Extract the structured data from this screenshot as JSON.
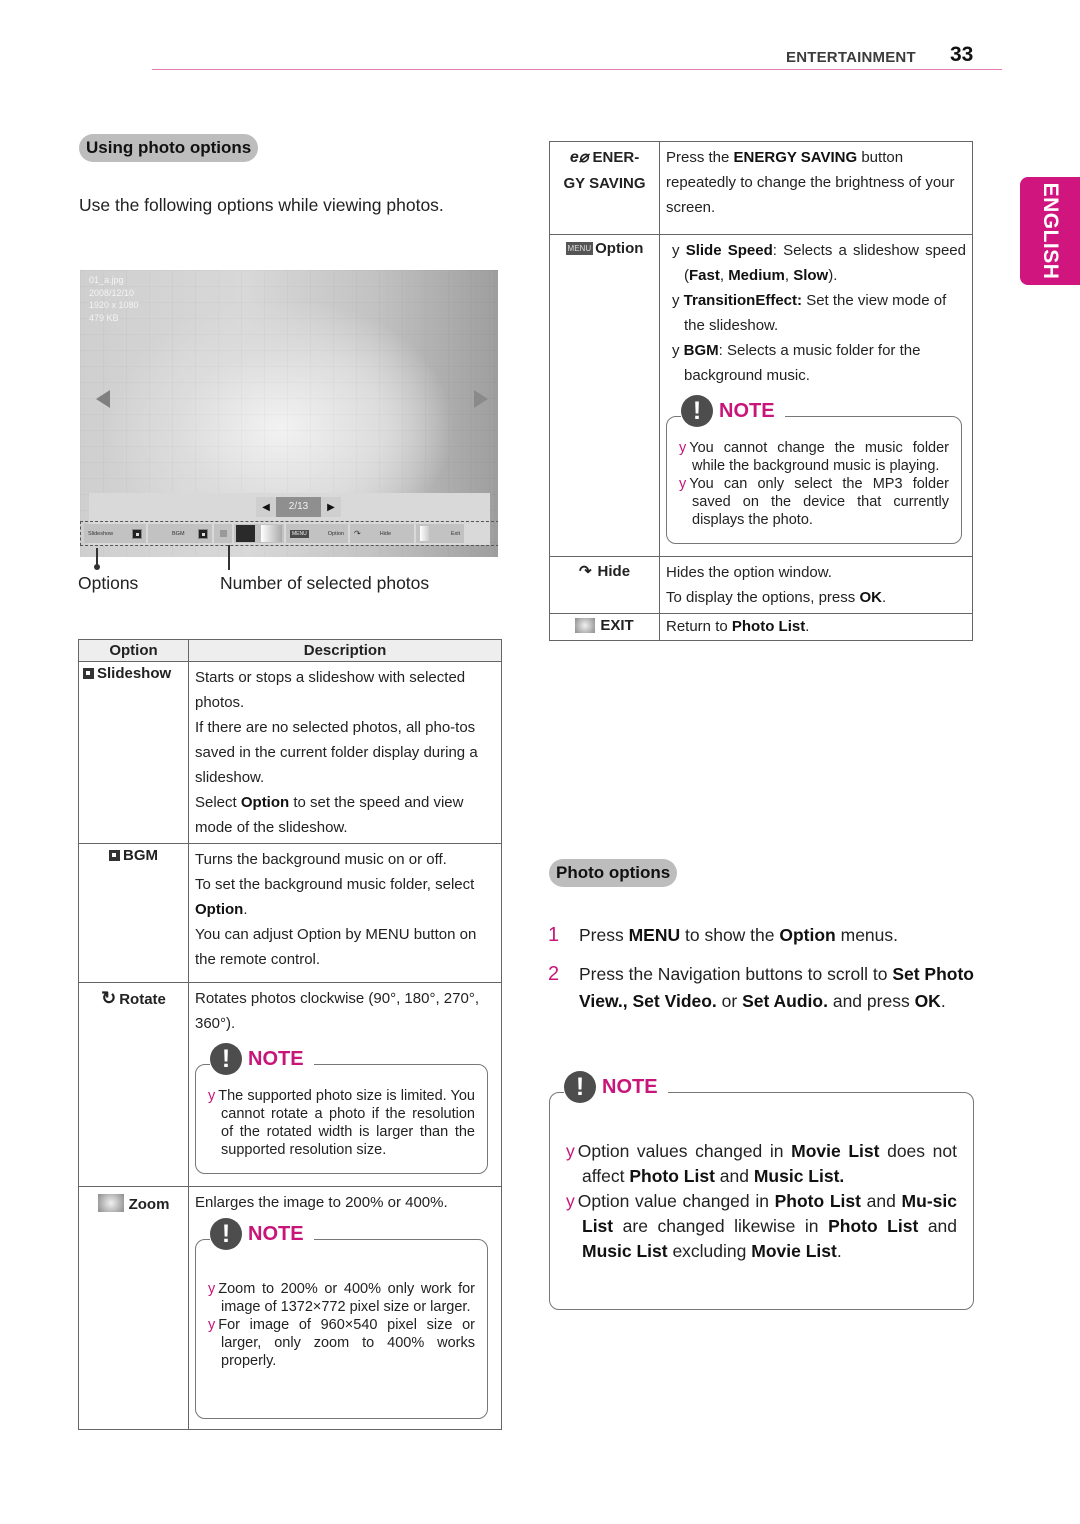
{
  "header": {
    "section": "ENTERTAINMENT",
    "page_number": "33"
  },
  "language_tab": "ENGLISH",
  "left": {
    "section_title": "Using photo options",
    "intro": "Use the following options while viewing photos.",
    "photo_screen": {
      "meta": [
        "01_a.jpg",
        "2008/12/10",
        "1920 x 1080",
        "479 KB"
      ],
      "counter": "2/13",
      "buttons": [
        "Slideshow",
        "BGM",
        "Option",
        "Hide",
        "Exit"
      ],
      "menu_badge": "MENU"
    },
    "captions": {
      "options": "Options",
      "selected": "Number of selected photos"
    },
    "table": {
      "headers": [
        "Option",
        "Description"
      ],
      "rows": [
        {
          "label": "Slideshow",
          "icon": "play-square-icon",
          "desc": [
            "Starts or stops a slideshow with selected photos.",
            "If there are no selected photos, all pho-tos saved in the current folder display during a slideshow."
          ],
          "desc3_pre": "Select ",
          "desc3_bold": "Option",
          "desc3_post": " to set the speed and view mode of the slideshow."
        },
        {
          "label": "BGM",
          "icon": "stop-square-icon",
          "desc1": "Turns the background music on or off.",
          "desc2_pre": "To set the background music folder, select ",
          "desc2_bold": "Option",
          "desc2_post": ".",
          "desc3": "You can adjust Option by MENU button on the remote control."
        },
        {
          "label": "Rotate",
          "icon": "rotate-icon",
          "icon_glyph": "↻",
          "desc": "Rotates photos clockwise (90°, 180°, 270°, 360°).",
          "note": {
            "title": "NOTE",
            "items": [
              "The supported photo size is limited. You cannot rotate a photo if the resolution of the rotated width is larger than the supported resolution size."
            ]
          }
        },
        {
          "label": "Zoom",
          "icon": "zoom-icon",
          "desc": "Enlarges the image to 200% or 400%.",
          "note": {
            "title": "NOTE",
            "items": [
              "Zoom to 200% or 400% only work for image of 1372×772 pixel size or larger.",
              "For image of 960×540 pixel size or larger, only zoom to 400% works properly."
            ]
          }
        }
      ]
    }
  },
  "right": {
    "table": {
      "energy": {
        "glyph": "e⌀",
        "label_1": "ENER-",
        "label_2": "GY SAVING",
        "desc_pre": "Press the ",
        "desc_bold": "ENERGY SAVING",
        "desc_post": " button repeatedly to change the brightness of your screen."
      },
      "option": {
        "badge": "MENU",
        "label": "Option",
        "items": [
          {
            "bold": "Slide Speed",
            "text": ": Selects a slideshow speed (",
            "b1": "Fast",
            "s1": ", ",
            "b2": "Medium",
            "s2": ", ",
            "b3": "Slow",
            "end": ")."
          },
          {
            "bold": "TransitionEffect:",
            "text": " Set the view mode of the slideshow."
          },
          {
            "bold": "BGM",
            "text": ": Selects a music folder for the background music."
          }
        ],
        "note": {
          "title": "NOTE",
          "items": [
            "You cannot change the music folder while the background music is playing.",
            "You can only select the MP3 folder saved on the device that currently displays the photo."
          ]
        }
      },
      "hide": {
        "glyph": "↷",
        "label": "Hide",
        "desc1": "Hides the option window.",
        "desc2_pre": "To display the options, press ",
        "desc2_bold": "OK",
        "desc2_post": "."
      },
      "exit": {
        "label": "EXIT",
        "desc_pre": "Return to ",
        "desc_bold": "Photo List",
        "desc_post": "."
      }
    },
    "section_title": "Photo options",
    "steps": [
      {
        "n": "1",
        "pre": "Press ",
        "b1": "MENU",
        "mid": " to show the ",
        "b2": "Option",
        "post": " menus."
      },
      {
        "n": "2",
        "pre": "Press the Navigation buttons to scroll to ",
        "b1": "Set Photo View., Set Video.",
        "mid": " or ",
        "b2": "Set Audio.",
        "post": " and press ",
        "b3": "OK",
        "end": "."
      }
    ],
    "note": {
      "title": "NOTE",
      "item1": {
        "t1": "Option values changed in ",
        "b1": "Movie List",
        "t2": " does not affect ",
        "b2": "Photo List",
        "t3": " and ",
        "b3": "Music List."
      },
      "item2": {
        "t1": "Option value changed in ",
        "b1": "Photo List",
        "t2": " and ",
        "b2": "Mu-sic List",
        "t3": " are changed likewise in ",
        "b3": "Photo List",
        "t4": " and ",
        "b4": "Music List",
        "t5": " excluding ",
        "b5": "Movie List",
        "t6": "."
      }
    },
    "bullet_glyph": "y"
  },
  "colors": {
    "accent": "#c8157a",
    "tab": "#d1157f",
    "header_rule": "#e57ab5",
    "pill": "#bdbdbd"
  }
}
